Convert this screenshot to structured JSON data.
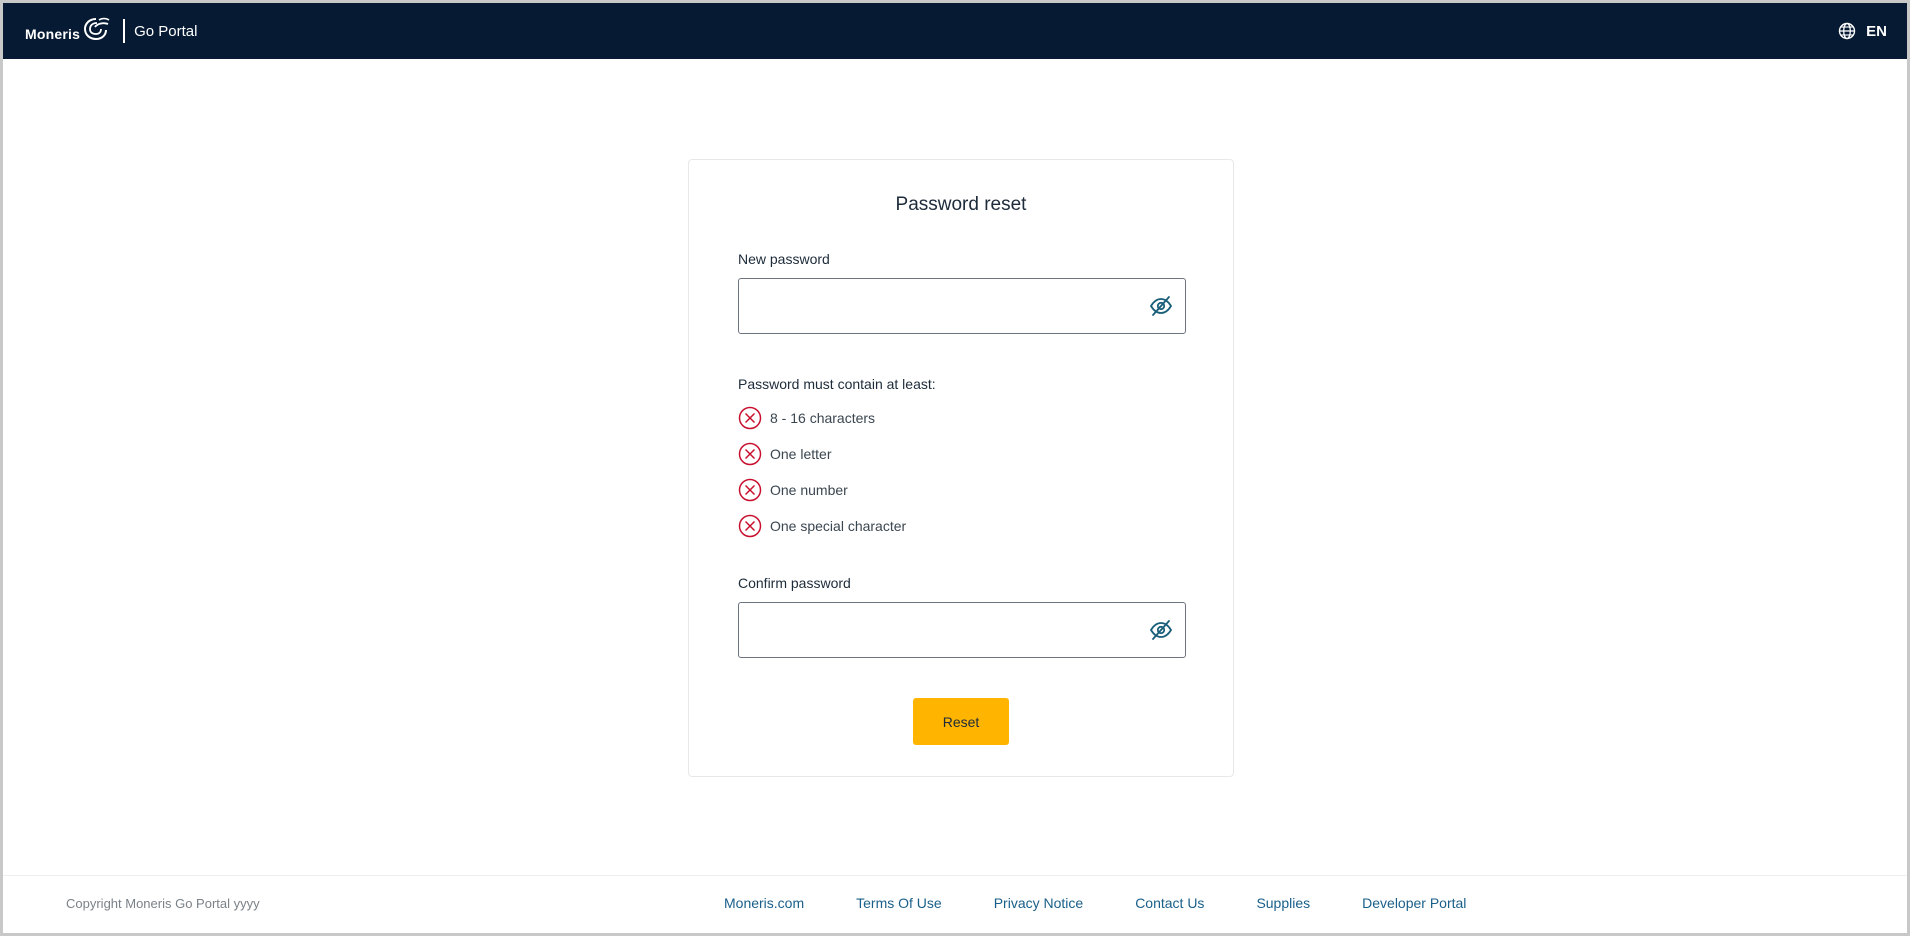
{
  "header": {
    "logo_text": "Moneris",
    "product_name": "Go Portal",
    "language": "EN",
    "language_icon": "globe-icon"
  },
  "form": {
    "title": "Password reset",
    "new_password": {
      "label": "New password",
      "value": "",
      "toggle_icon": "eye-hidden-icon"
    },
    "rules_title": "Password must contain at least:",
    "rules": [
      {
        "text": "8 - 16 characters",
        "status": "unmet",
        "icon": "x-circle-icon"
      },
      {
        "text": "One letter",
        "status": "unmet",
        "icon": "x-circle-icon"
      },
      {
        "text": "One number",
        "status": "unmet",
        "icon": "x-circle-icon"
      },
      {
        "text": "One special character",
        "status": "unmet",
        "icon": "x-circle-icon"
      }
    ],
    "confirm_password": {
      "label": "Confirm password",
      "value": "",
      "toggle_icon": "eye-hidden-icon"
    },
    "reset_label": "Reset"
  },
  "footer": {
    "copyright": "Copyright Moneris Go Portal  yyyy",
    "links": [
      {
        "label": "Moneris.com"
      },
      {
        "label": "Terms Of Use"
      },
      {
        "label": "Privacy Notice"
      },
      {
        "label": "Contact Us"
      },
      {
        "label": "Supplies"
      },
      {
        "label": "Developer Portal"
      }
    ]
  },
  "colors": {
    "header_bg": "#061b33",
    "primary_button": "#ffb400",
    "error_icon": "#c8102e",
    "link": "#1a5f8a"
  }
}
